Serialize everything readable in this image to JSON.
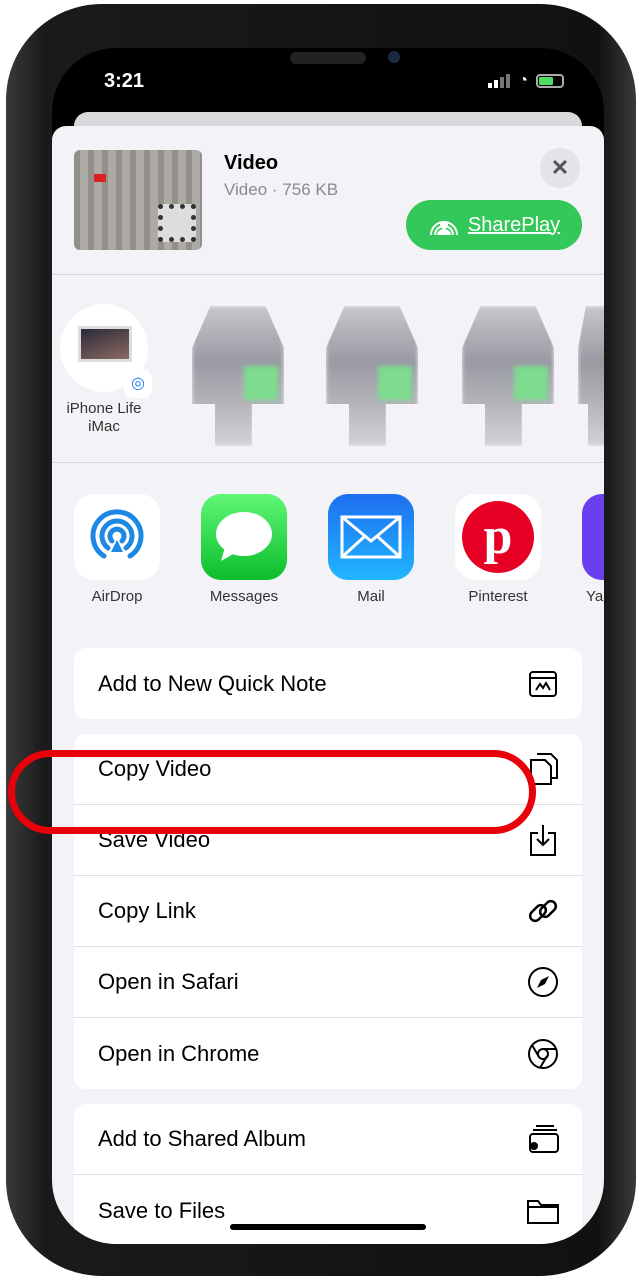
{
  "status_bar": {
    "time": "3:21",
    "icons": [
      "signal-icon",
      "wifi-icon",
      "battery-charging-icon"
    ]
  },
  "header": {
    "title": "Video",
    "subtitle": "Video · 756 KB",
    "shareplay_label": "SharePlay",
    "close_icon": "close-icon"
  },
  "people": [
    {
      "label": "iPhone Life iMac"
    }
  ],
  "apps": [
    {
      "label": "AirDrop"
    },
    {
      "label": "Messages"
    },
    {
      "label": "Mail"
    },
    {
      "label": "Pinterest"
    },
    {
      "label": "Ya"
    }
  ],
  "actions": {
    "group1": [
      {
        "label": "Add to New Quick Note",
        "icon": "quick-note-icon"
      }
    ],
    "group2": [
      {
        "label": "Copy Video",
        "icon": "copy-icon"
      },
      {
        "label": "Save Video",
        "icon": "save-icon"
      },
      {
        "label": "Copy Link",
        "icon": "link-icon"
      },
      {
        "label": "Open in Safari",
        "icon": "compass-icon"
      },
      {
        "label": "Open in Chrome",
        "icon": "chrome-icon"
      }
    ],
    "group3": [
      {
        "label": "Add to Shared Album",
        "icon": "shared-album-icon"
      },
      {
        "label": "Save to Files",
        "icon": "folder-icon"
      }
    ]
  },
  "colors": {
    "highlight": "#e8000b",
    "shareplay": "#34c759",
    "sheet": "#f2f2f7"
  }
}
